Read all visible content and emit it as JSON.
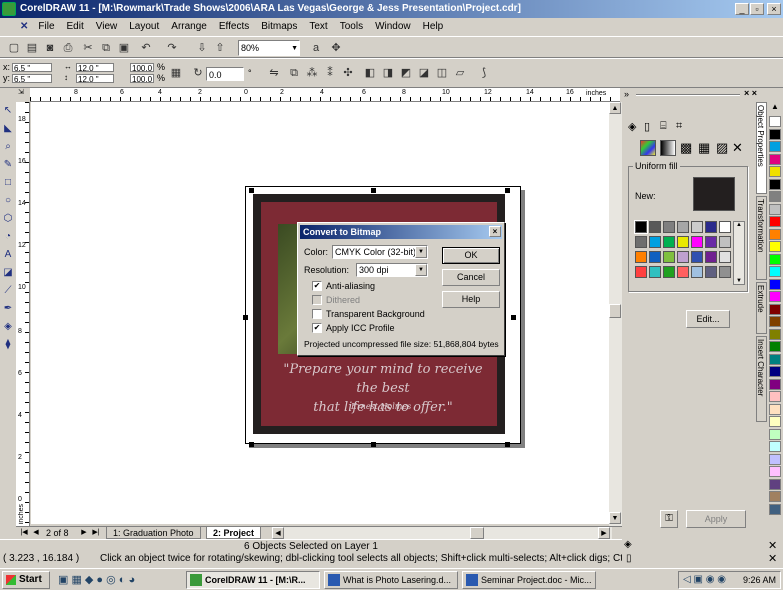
{
  "window": {
    "title": "CorelDRAW 11 - [M:\\Rowmark\\Trade Shows\\2006\\ARA Las Vegas\\George & Jess Presentation\\Project.cdr]",
    "minimize": "_",
    "maximize": "▫",
    "close": "×"
  },
  "menu": [
    "File",
    "Edit",
    "View",
    "Layout",
    "Arrange",
    "Effects",
    "Bitmaps",
    "Text",
    "Tools",
    "Window",
    "Help"
  ],
  "toolbar": {
    "zoom": "80%",
    "snap_label": "a"
  },
  "property_bar": {
    "x": "6.5 \"",
    "y": "6.5 \"",
    "width": "12.0 \"",
    "height": "12.0 \"",
    "scale_x": "100.0",
    "scale_y": "100.0",
    "percent_x": "%",
    "percent_y": "%",
    "rotation": "0.0",
    "degree": "°",
    "x_label": "x:",
    "y_label": "y:"
  },
  "rulers": {
    "units": "inches",
    "h_ticks": [
      "8",
      "6",
      "4",
      "2",
      "0",
      "2",
      "4",
      "6",
      "8",
      "10",
      "12",
      "14",
      "16"
    ],
    "v_ticks": [
      "18",
      "16",
      "14",
      "12",
      "10",
      "8",
      "6",
      "4",
      "2",
      "0",
      "2"
    ],
    "v_units": "inches"
  },
  "artwork": {
    "quote_line1": "\"Prepare your mind to receive the best",
    "quote_line2": "that life has to offer.\"",
    "signature": "Ernest Holmes"
  },
  "dialog": {
    "title": "Convert to Bitmap",
    "color_label": "Color:",
    "color_value": "CMYK Color (32-bit)",
    "resolution_label": "Resolution:",
    "resolution_value": "300 dpi",
    "anti_aliasing": "Anti-aliasing",
    "anti_aliasing_checked": true,
    "dithered": "Dithered",
    "dithered_checked": false,
    "transparent_bg": "Transparent Background",
    "transparent_checked": false,
    "apply_icc": "Apply ICC Profile",
    "apply_icc_checked": true,
    "file_size": "Projected uncompressed file size: 51,868,804 bytes",
    "ok": "OK",
    "cancel": "Cancel",
    "help": "Help",
    "close": "×"
  },
  "page_nav": {
    "counter": "2 of 8",
    "tab1": "1: Graduation Photo",
    "tab2": "2: Project"
  },
  "docker": {
    "fill_group": "Uniform fill",
    "new_label": "New:",
    "edit_button": "Edit...",
    "apply_button": "Apply",
    "tabs": [
      "Object Properties",
      "Transformation",
      "Extrude",
      "Insert Character"
    ],
    "new_color": "#231f1f"
  },
  "status": {
    "selection": "6 Objects Selected on Layer 1",
    "coords": "( 3.223 , 16.184 )",
    "hint": "Click an object twice for rotating/skewing; dbl-clicking tool selects all objects; Shift+click multi-selects; Alt+click digs; Ctrl+click selects in a group"
  },
  "taskbar": {
    "start": "Start",
    "tasks": [
      "CorelDRAW 11 - [M:\\R...",
      "What is Photo Lasering.d...",
      "Seminar Project.doc - Mic..."
    ],
    "clock": "9:26 AM"
  }
}
